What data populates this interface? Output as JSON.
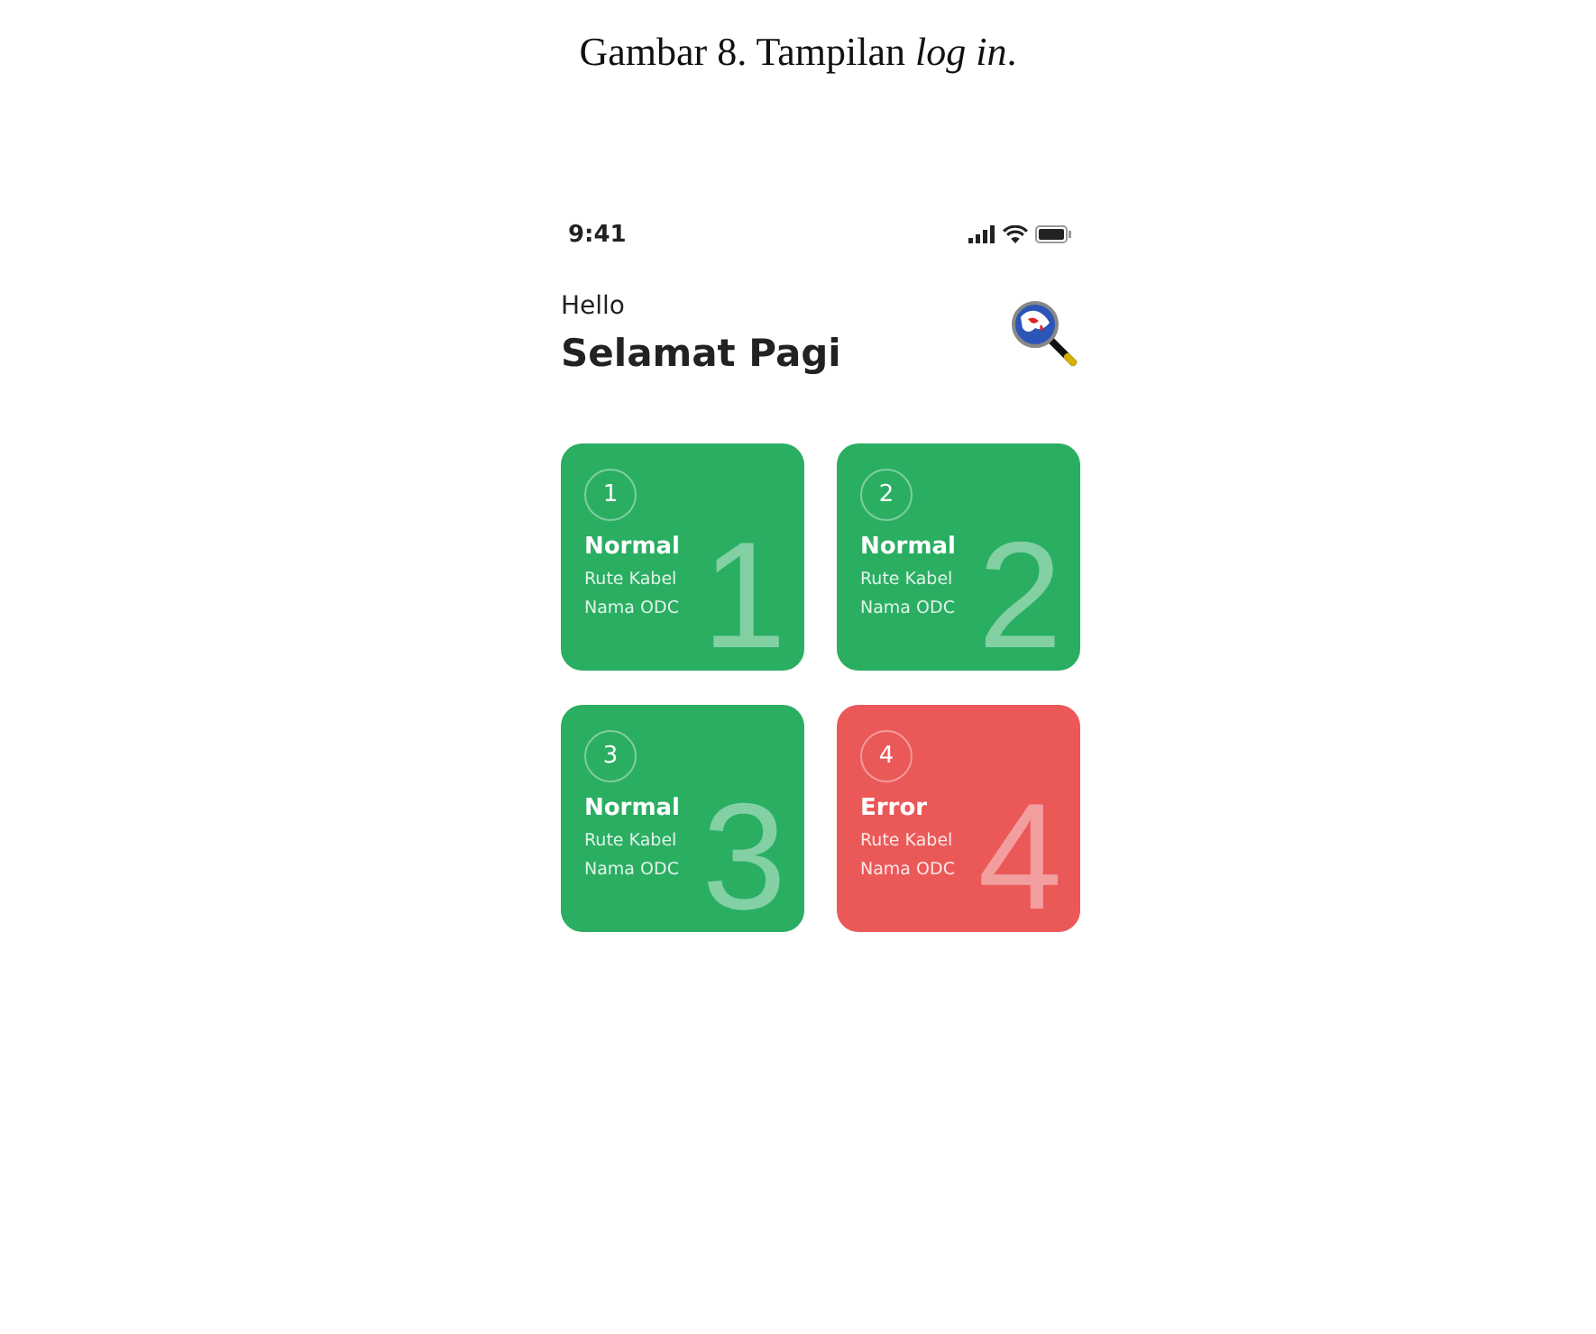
{
  "caption": "Gambar 8. Tampilan *log in*.",
  "phone": {
    "status_bar": {
      "time": "9:41"
    },
    "greeting": "Hello",
    "title": "Selamat Pagi",
    "cards": [
      {
        "badge": "1",
        "status": "Normal",
        "route": "Rute Kabel",
        "odc": "Nama ODC",
        "numeral": "1",
        "color": "#2aae62"
      },
      {
        "badge": "2",
        "status": "Normal",
        "route": "Rute Kabel",
        "odc": "Nama ODC",
        "numeral": "2",
        "color": "#2aae62"
      },
      {
        "badge": "3",
        "status": "Normal",
        "route": "Rute Kabel",
        "odc": "Nama ODC",
        "numeral": "3",
        "color": "#2aae62"
      },
      {
        "badge": "4",
        "status": "Error",
        "route": "Rute Kabel",
        "odc": "Nama ODC",
        "numeral": "4",
        "color": "#eb5858"
      }
    ]
  }
}
